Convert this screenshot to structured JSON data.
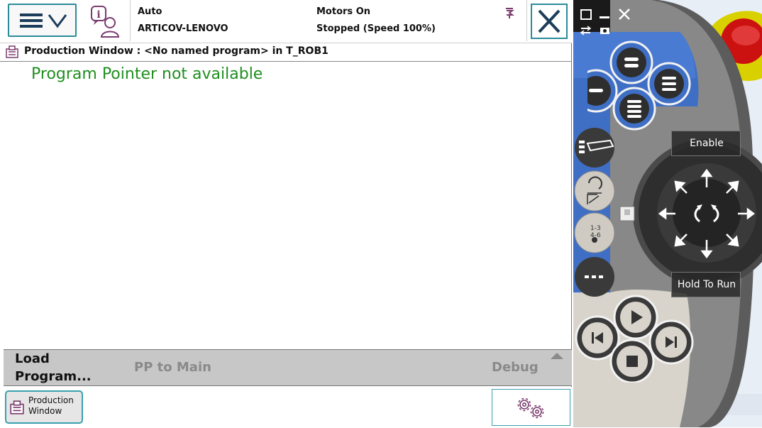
{
  "status": {
    "mode": "Auto",
    "controller": "ARTICOV-LENOVO",
    "motors": "Motors On",
    "state": "Stopped (Speed 100%)"
  },
  "window": {
    "title": "Production Window : <No named program> in T_ROB1",
    "message": "Program Pointer not available"
  },
  "commands": {
    "load_line1": "Load",
    "load_line2": "Program...",
    "pp_to_main": "PP to Main",
    "debug": "Debug"
  },
  "taskbar": {
    "production_line1": "Production",
    "production_line2": "Window"
  },
  "pendant": {
    "enable": "Enable",
    "hold_to_run": "Hold To Run"
  },
  "icons": {
    "menu": "hamburger-chevron-icon",
    "info": "event-log-info-icon",
    "close": "close-x-icon",
    "quickset": "gears-icon",
    "production": "production-window-icon"
  },
  "colors": {
    "accent": "#2a8c99",
    "pp_message": "#1f8f1f",
    "disabled_text": "#8a8a8a",
    "command_bar": "#c7c7c7",
    "pendant_blue": "#3f6fc5"
  }
}
